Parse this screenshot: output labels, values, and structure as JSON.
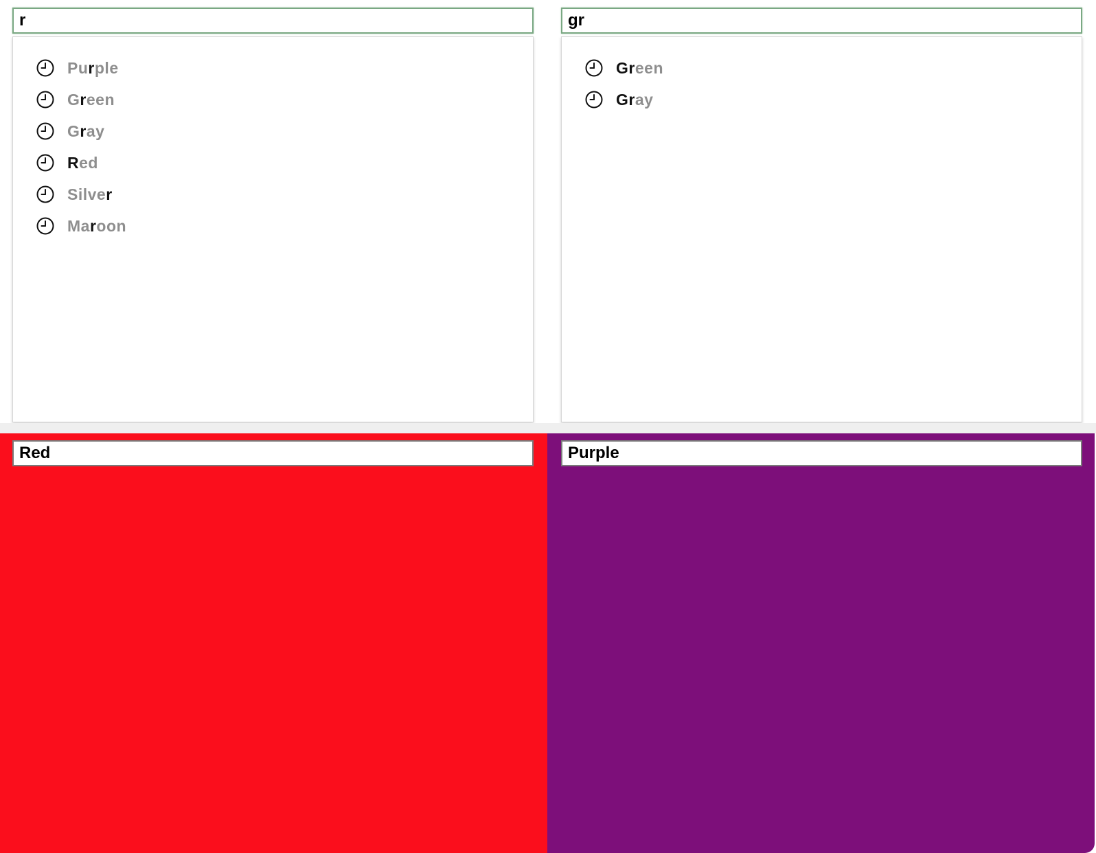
{
  "colors": {
    "red_panel": "#fb0e1c",
    "purple_panel": "#7d0f7a",
    "match_text": "#111111",
    "rest_text": "#8e8e8e",
    "focus_border": "#7aa883"
  },
  "top_left": {
    "input_value": "r",
    "suggestions": [
      {
        "icon": "clock-icon",
        "label": "Purple",
        "match": [
          2
        ]
      },
      {
        "icon": "clock-icon",
        "label": "Green",
        "match": [
          1
        ]
      },
      {
        "icon": "clock-icon",
        "label": "Gray",
        "match": [
          1
        ]
      },
      {
        "icon": "clock-icon",
        "label": "Red",
        "match": [
          0
        ]
      },
      {
        "icon": "clock-icon",
        "label": "Silver",
        "match": [
          5
        ]
      },
      {
        "icon": "clock-icon",
        "label": "Maroon",
        "match": [
          2
        ]
      }
    ]
  },
  "top_right": {
    "input_value": "gr",
    "suggestions": [
      {
        "icon": "clock-icon",
        "label": "Green",
        "match": [
          0,
          1
        ]
      },
      {
        "icon": "clock-icon",
        "label": "Gray",
        "match": [
          0,
          1
        ]
      }
    ]
  },
  "bottom_left": {
    "input_value": "Red"
  },
  "bottom_right": {
    "input_value": "Purple"
  }
}
